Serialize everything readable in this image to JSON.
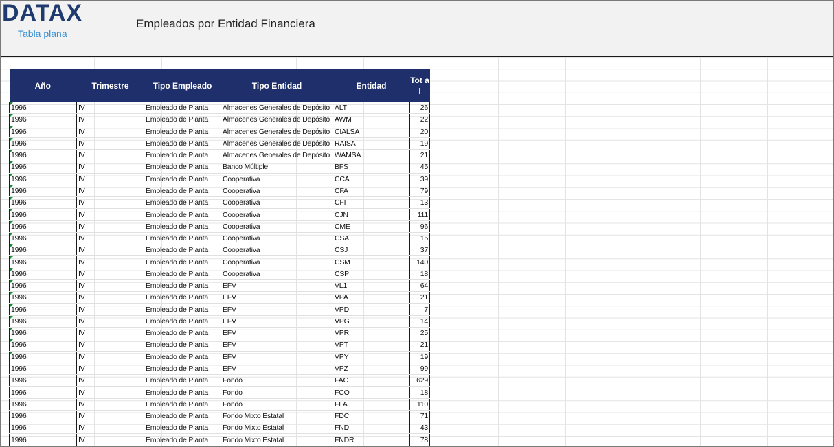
{
  "header": {
    "logo": "DATAX",
    "logo_subtitle": "Tabla plana",
    "title": "Empleados por Entidad Financiera"
  },
  "table": {
    "columns": [
      "Año",
      "Trimestre",
      "Tipo Empleado",
      "Tipo Entidad",
      "Entidad",
      "Tot al"
    ],
    "rows": [
      [
        "1996",
        "IV",
        "Empleado de Planta",
        "Almacenes Generales de Depósito",
        "ALT",
        "26"
      ],
      [
        "1996",
        "IV",
        "Empleado de Planta",
        "Almacenes Generales de Depósito",
        "AWM",
        "22"
      ],
      [
        "1996",
        "IV",
        "Empleado de Planta",
        "Almacenes Generales de Depósito",
        "CIALSA",
        "20"
      ],
      [
        "1996",
        "IV",
        "Empleado de Planta",
        "Almacenes Generales de Depósito",
        "RAISA",
        "19"
      ],
      [
        "1996",
        "IV",
        "Empleado de Planta",
        "Almacenes Generales de Depósito",
        "WAMSA",
        "21"
      ],
      [
        "1996",
        "IV",
        "Empleado de Planta",
        "Banco Múltiple",
        "BFS",
        "45"
      ],
      [
        "1996",
        "IV",
        "Empleado de Planta",
        "Cooperativa",
        "CCA",
        "39"
      ],
      [
        "1996",
        "IV",
        "Empleado de Planta",
        "Cooperativa",
        "CFA",
        "79"
      ],
      [
        "1996",
        "IV",
        "Empleado de Planta",
        "Cooperativa",
        "CFI",
        "13"
      ],
      [
        "1996",
        "IV",
        "Empleado de Planta",
        "Cooperativa",
        "CJN",
        "111"
      ],
      [
        "1996",
        "IV",
        "Empleado de Planta",
        "Cooperativa",
        "CME",
        "96"
      ],
      [
        "1996",
        "IV",
        "Empleado de Planta",
        "Cooperativa",
        "CSA",
        "15"
      ],
      [
        "1996",
        "IV",
        "Empleado de Planta",
        "Cooperativa",
        "CSJ",
        "37"
      ],
      [
        "1996",
        "IV",
        "Empleado de Planta",
        "Cooperativa",
        "CSM",
        "140"
      ],
      [
        "1996",
        "IV",
        "Empleado de Planta",
        "Cooperativa",
        "CSP",
        "18"
      ],
      [
        "1996",
        "IV",
        "Empleado de Planta",
        "EFV",
        "VL1",
        "64"
      ],
      [
        "1996",
        "IV",
        "Empleado de Planta",
        "EFV",
        "VPA",
        "21"
      ],
      [
        "1996",
        "IV",
        "Empleado de Planta",
        "EFV",
        "VPD",
        "7"
      ],
      [
        "1996",
        "IV",
        "Empleado de Planta",
        "EFV",
        "VPG",
        "14"
      ],
      [
        "1996",
        "IV",
        "Empleado de Planta",
        "EFV",
        "VPR",
        "25"
      ],
      [
        "1996",
        "IV",
        "Empleado de Planta",
        "EFV",
        "VPT",
        "21"
      ],
      [
        "1996",
        "IV",
        "Empleado de Planta",
        "EFV",
        "VPY",
        "19"
      ],
      [
        "1996",
        "IV",
        "Empleado de Planta",
        "EFV",
        "VPZ",
        "99"
      ],
      [
        "1996",
        "IV",
        "Empleado de Planta",
        "Fondo",
        "FAC",
        "629"
      ],
      [
        "1996",
        "IV",
        "Empleado de Planta",
        "Fondo",
        "FCO",
        "18"
      ],
      [
        "1996",
        "IV",
        "Empleado de Planta",
        "Fondo",
        "FLA",
        "110"
      ],
      [
        "1996",
        "IV",
        "Empleado de Planta",
        "Fondo Mixto Estatal",
        "FDC",
        "71"
      ],
      [
        "1996",
        "IV",
        "Empleado de Planta",
        "Fondo Mixto Estatal",
        "FND",
        "43"
      ],
      [
        "1996",
        "IV",
        "Empleado de Planta",
        "Fondo Mixto Estatal",
        "FNDR",
        "78"
      ]
    ],
    "marked_rows": 22
  },
  "colors": {
    "header_bg": "#1f2f6b",
    "logo": "#1f3a6e",
    "logo_subtitle": "#3a8fd0",
    "error_marker": "#1e8a3a"
  }
}
